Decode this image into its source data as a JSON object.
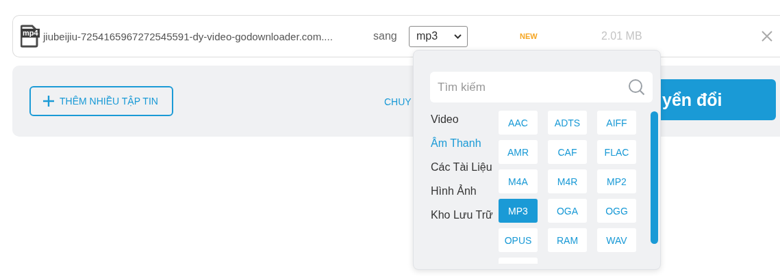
{
  "file": {
    "format_badge": "mp4",
    "name": "jiubeijiu-7254165967272545591-dy-video-godownloader.com....",
    "to_label": "sang",
    "target_format": "mp3",
    "badge": "NEW",
    "size": "2.01 MB"
  },
  "actions": {
    "add_files_button": "THÊM NHIỀU TẬP TIN",
    "convert_all_link": "CHUY",
    "convert_button": "yển đổi"
  },
  "format_menu": {
    "search": {
      "placeholder": "Tìm kiếm"
    },
    "categories": [
      {
        "label": "Video",
        "selected": false
      },
      {
        "label": "Âm Thanh",
        "selected": true
      },
      {
        "label": "Các Tài Liệu",
        "selected": false
      },
      {
        "label": "Hình Ảnh",
        "selected": false
      },
      {
        "label": "Kho Lưu Trữ",
        "selected": false
      }
    ],
    "formats": [
      {
        "label": "AAC",
        "selected": false
      },
      {
        "label": "ADTS",
        "selected": false
      },
      {
        "label": "AIFF",
        "selected": false
      },
      {
        "label": "AMR",
        "selected": false
      },
      {
        "label": "CAF",
        "selected": false
      },
      {
        "label": "FLAC",
        "selected": false
      },
      {
        "label": "M4A",
        "selected": false
      },
      {
        "label": "M4R",
        "selected": false
      },
      {
        "label": "MP2",
        "selected": false
      },
      {
        "label": "MP3",
        "selected": true
      },
      {
        "label": "OGA",
        "selected": false
      },
      {
        "label": "OGG",
        "selected": false
      },
      {
        "label": "OPUS",
        "selected": false
      },
      {
        "label": "RAM",
        "selected": false
      },
      {
        "label": "WAV",
        "selected": false
      }
    ]
  }
}
